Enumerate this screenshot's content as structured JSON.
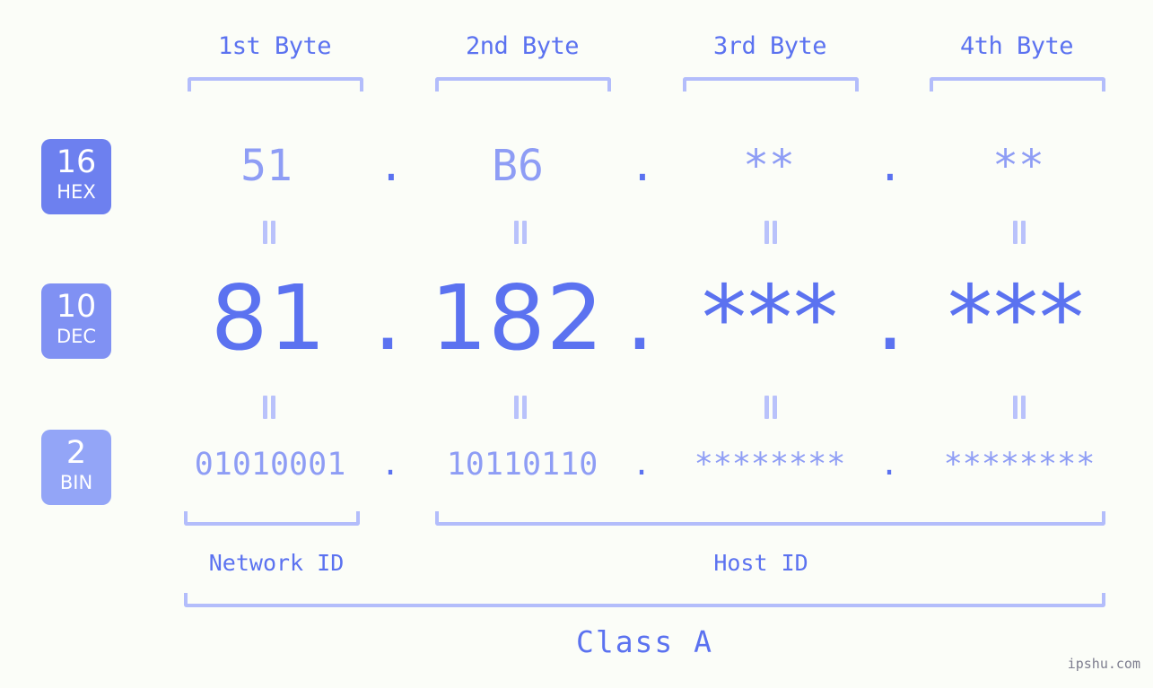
{
  "background_color": "#fbfdf8",
  "accent_color": "#5b72f0",
  "accent_light_color": "#8e9df5",
  "bracket_color": "#b3bdfb",
  "header": {
    "byte_labels": [
      {
        "label": "1st Byte"
      },
      {
        "label": "2nd Byte"
      },
      {
        "label": "3rd Byte"
      },
      {
        "label": "4th Byte"
      }
    ]
  },
  "bases": [
    {
      "number": "16",
      "name": "HEX",
      "color": "#6d80ef"
    },
    {
      "number": "10",
      "name": "DEC",
      "color": "#8091f3"
    },
    {
      "number": "2",
      "name": "BIN",
      "color": "#93a5f7"
    }
  ],
  "rows": {
    "hex": {
      "values": [
        "51",
        "B6",
        "**",
        "**"
      ],
      "separator": "."
    },
    "dec": {
      "values": [
        "81",
        "182",
        "***",
        "***"
      ],
      "separator": "."
    },
    "bin": {
      "values": [
        "01010001",
        "10110110",
        "********",
        "********"
      ],
      "separator": "."
    }
  },
  "equals_separator": "||",
  "footer": {
    "network_id_label": "Network ID",
    "host_id_label": "Host ID",
    "class_label": "Class A"
  },
  "watermark": "ipshu.com"
}
